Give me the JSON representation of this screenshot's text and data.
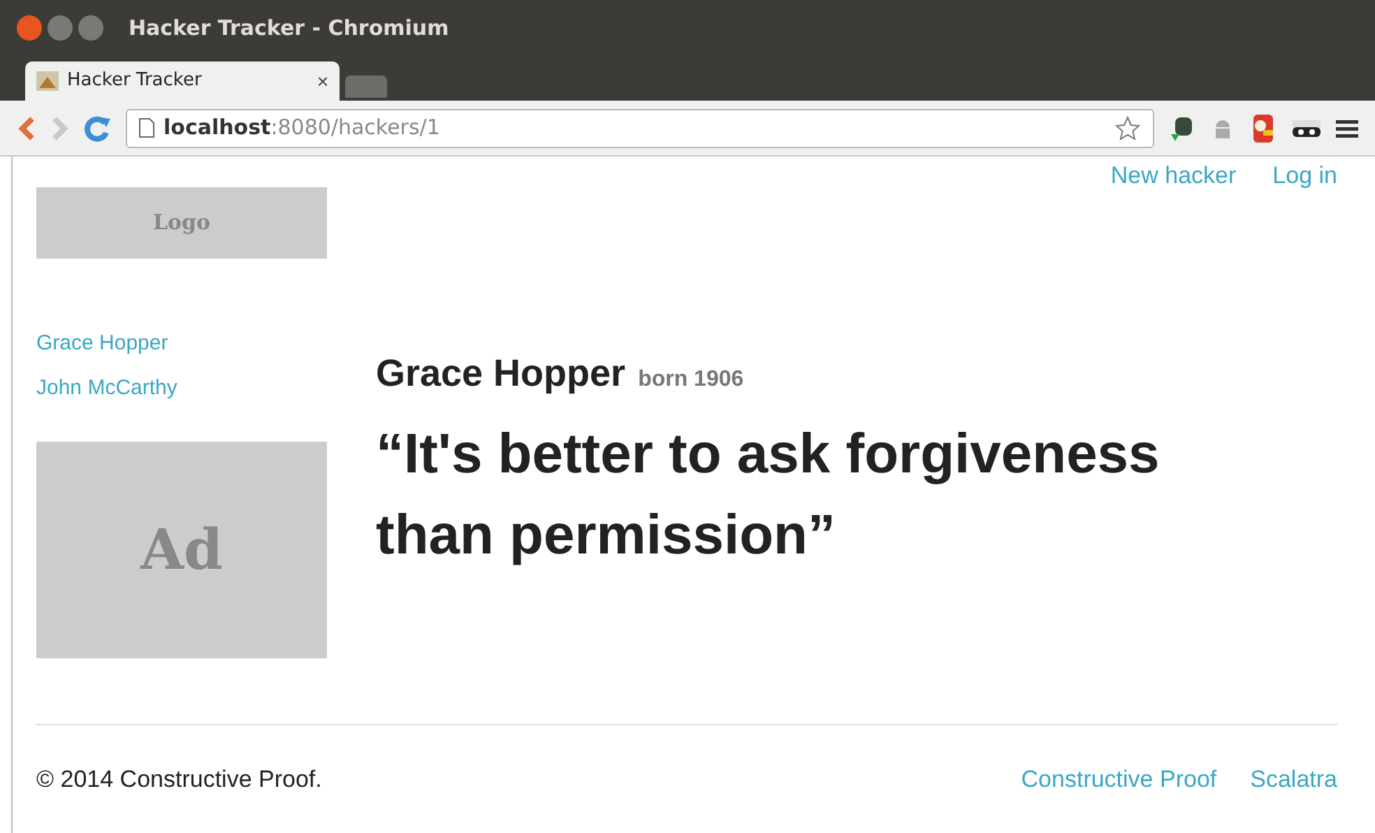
{
  "window": {
    "title": "Hacker Tracker - Chromium"
  },
  "tabs": [
    {
      "label": "Hacker Tracker",
      "close": "×",
      "selected": true
    }
  ],
  "address_bar": {
    "url": "**localhost**:8080/hackers/1"
  },
  "header": {
    "links": [
      "New hacker",
      "Log in"
    ]
  },
  "sidebar": {
    "logo": "Logo",
    "items": [
      "Grace Hopper",
      "John McCarthy"
    ],
    "ad": "Ad"
  },
  "hacker": {
    "name": "Grace Hopper",
    "born": "born 1906",
    "quote": "“It's better to ask forgiveness than permission”"
  },
  "footer": {
    "copyright": "© 2014 Constructive Proof.",
    "links": [
      "Constructive Proof",
      "Scalatra"
    ]
  }
}
